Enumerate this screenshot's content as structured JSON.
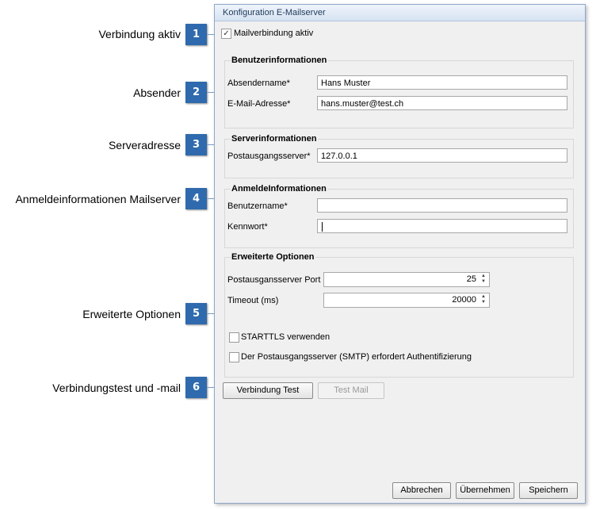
{
  "callouts": [
    {
      "number": "1",
      "text": "Verbindung aktiv"
    },
    {
      "number": "2",
      "text": "Absender"
    },
    {
      "number": "3",
      "text": "Serveradresse"
    },
    {
      "number": "4",
      "text": "Anmeldeinformationen Mailserver"
    },
    {
      "number": "5",
      "text": "Erweiterte Optionen"
    },
    {
      "number": "6",
      "text": "Verbindungstest und -mail"
    }
  ],
  "dialog": {
    "title": "Konfiguration E-Mailserver",
    "mail_active": {
      "label": "Mailverbindung aktiv",
      "checked": true,
      "mark": "✓"
    },
    "sender": {
      "title": "Benutzerinformationen",
      "name_label": "Absendername*",
      "name_value": "Hans Muster",
      "email_label": "E-Mail-Adresse*",
      "email_value": "hans.muster@test.ch"
    },
    "server": {
      "title": "Serverinformationen",
      "smtp_label": "Postausgangsserver*",
      "smtp_value": "127.0.0.1"
    },
    "login": {
      "title": "AnmeldeInformationen",
      "user_label": "Benutzername*",
      "user_value": "",
      "password_label": "Kennwort*",
      "password_value": ""
    },
    "advanced": {
      "title": "Erweiterte Optionen",
      "port_label": "Postausgansserver Port",
      "port_value": "25",
      "timeout_label": "Timeout (ms)",
      "timeout_value": "20000",
      "spin_up": "▲",
      "spin_down": "▼",
      "starttls_label": "STARTTLS verwenden",
      "starttls_checked": false,
      "smtp_auth_label": "Der Postausgangsserver (SMTP) erfordert Authentifizierung",
      "smtp_auth_checked": false
    },
    "test": {
      "connection_label": "Verbindung Test",
      "mail_label": "Test Mail",
      "mail_enabled": false
    },
    "footer": {
      "cancel_label": "Abbrechen",
      "apply_label": "Übernehmen",
      "save_label": "Speichern"
    }
  },
  "colors": {
    "badge": "#2e6aad",
    "dialog_border": "#8fa8c8",
    "title_text": "#1e395b"
  }
}
